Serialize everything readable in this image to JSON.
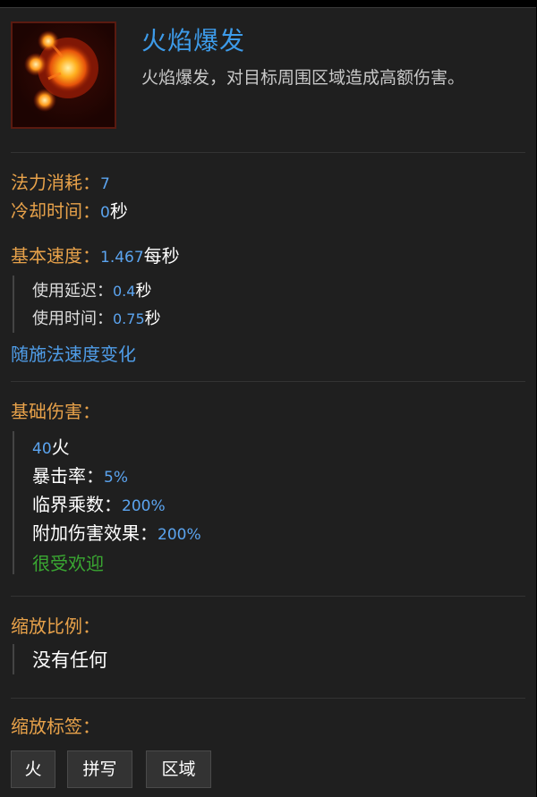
{
  "skill": {
    "name": "火焰爆发",
    "description": "火焰爆发，对目标周围区域造成高额伤害。",
    "icon": "fireball-icon"
  },
  "stats": {
    "mana_label": "法力消耗：",
    "mana_value": "7",
    "cooldown_label": "冷却时间：",
    "cooldown_value": "0",
    "cooldown_unit": "秒",
    "speed_label": "基本速度：",
    "speed_value": "1.467",
    "speed_unit": "每秒",
    "delay_label": "使用延迟：",
    "delay_value": "0.4",
    "delay_unit": "秒",
    "use_time_label": "使用时间：",
    "use_time_value": "0.75",
    "use_time_unit": "秒",
    "cast_speed_note": "随施法速度变化"
  },
  "damage": {
    "header": "基础伤害：",
    "base_value": "40",
    "base_type": "火",
    "crit_label": "暴击率：",
    "crit_value": "5%",
    "multiplier_label": "临界乘数：",
    "multiplier_value": "200%",
    "effect_label": "附加伤害效果：",
    "effect_value": "200%",
    "popular_note": "很受欢迎"
  },
  "scaling": {
    "header": "缩放比例：",
    "value": "没有任何"
  },
  "tags": {
    "header": "缩放标签：",
    "items": [
      "火",
      "拼写",
      "区域"
    ]
  },
  "colors": {
    "background": "#1f1f1f",
    "title": "#3d9be9",
    "label": "#e8a24a",
    "value": "#5ba4ef",
    "popular": "#3aa832"
  }
}
